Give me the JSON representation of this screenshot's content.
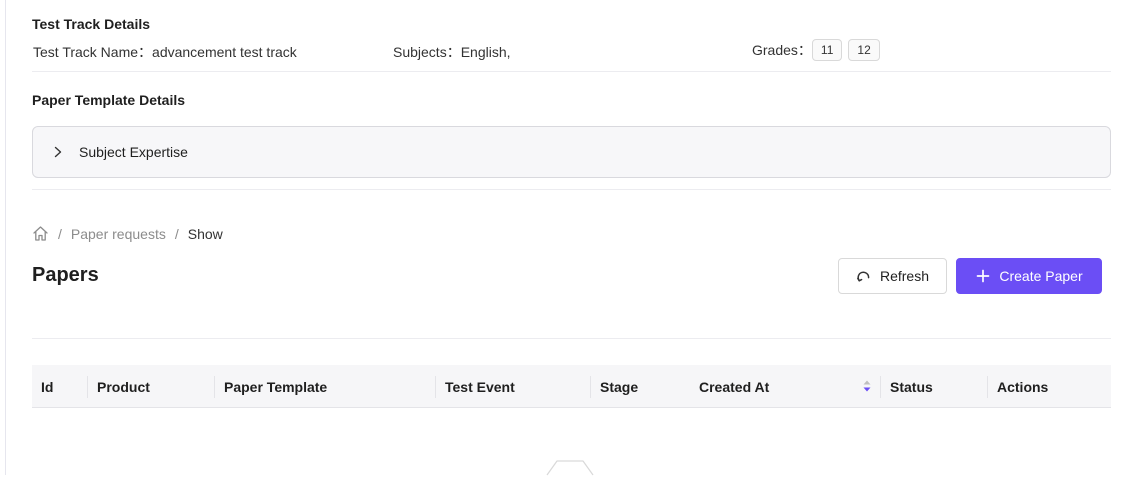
{
  "test_track": {
    "section_title": "Test Track Details",
    "name_label": "Test Track Name：",
    "name_value": "advancement test track",
    "subjects_label": "Subjects：",
    "subjects_value": "English,",
    "grades_label": "Grades：",
    "grades": [
      "11",
      "12"
    ]
  },
  "paper_template": {
    "section_title": "Paper Template Details",
    "collapse_label": "Subject Expertise"
  },
  "breadcrumb": {
    "items": [
      "Paper requests",
      "Show"
    ],
    "separator": "/"
  },
  "page": {
    "title": "Papers",
    "refresh_label": "Refresh",
    "create_label": "Create Paper"
  },
  "table": {
    "columns": [
      "Id",
      "Product",
      "Paper Template",
      "Test Event",
      "Stage",
      "Created At",
      "Status",
      "Actions"
    ]
  },
  "icons": {
    "home": "home-icon",
    "chevron": "chevron-right-icon",
    "refresh": "refresh-icon",
    "plus": "plus-icon",
    "sort": "sort-icon",
    "empty": "empty-box-icon"
  },
  "colors": {
    "primary": "#6b4ef5",
    "sort_active": "#6b4ef5"
  }
}
